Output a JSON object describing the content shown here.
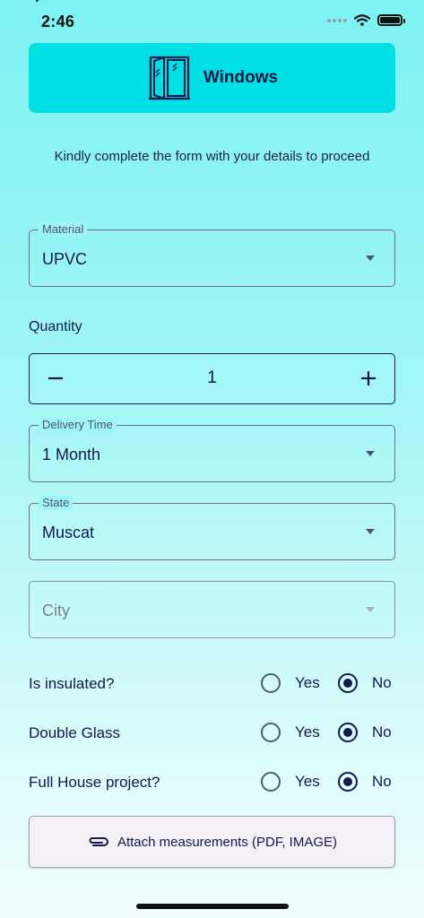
{
  "status_bar": {
    "time": "2:46"
  },
  "header": {
    "title": "Windows",
    "icon": "window-icon"
  },
  "intro_text": "Kindly complete the form with your details to proceed",
  "material": {
    "label": "Material",
    "value": "UPVC"
  },
  "quantity": {
    "label": "Quantity",
    "value": "1"
  },
  "delivery_time": {
    "label": "Delivery Time",
    "value": "1 Month"
  },
  "state": {
    "label": "State",
    "value": "Muscat"
  },
  "city": {
    "placeholder": "City"
  },
  "questions": [
    {
      "label": "Is insulated?",
      "yes": "Yes",
      "no": "No",
      "selected": "No"
    },
    {
      "label": "Double Glass",
      "yes": "Yes",
      "no": "No",
      "selected": "No"
    },
    {
      "label": "Full House project?",
      "yes": "Yes",
      "no": "No",
      "selected": "No"
    }
  ],
  "attach": {
    "label": "Attach measurements (PDF, IMAGE)",
    "icon": "paperclip-icon"
  },
  "colors": {
    "header_bg": "#00dfe3",
    "text": "#14184a",
    "attach_bg": "#f5eff6"
  }
}
